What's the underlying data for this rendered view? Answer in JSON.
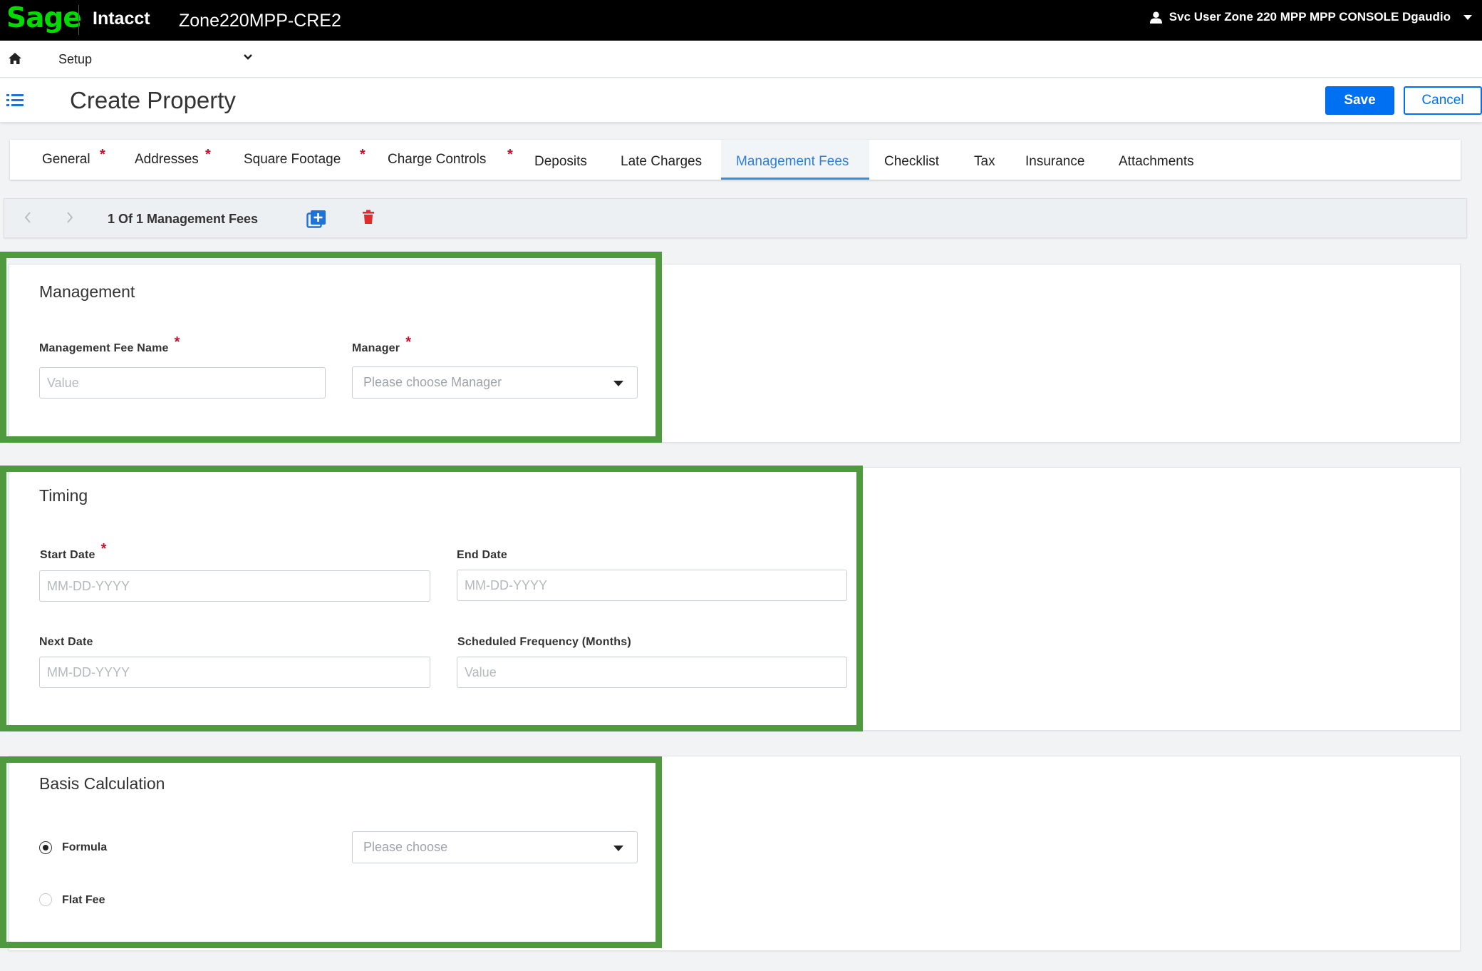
{
  "topbar": {
    "logo": "Sage",
    "product": "Intacct",
    "company": "Zone220MPP-CRE2",
    "user": "Svc User Zone 220 MPP MPP CONSOLE Dgaudio"
  },
  "nav": {
    "menu": "Setup"
  },
  "header": {
    "title": "Create Property",
    "save_label": "Save",
    "cancel_label": "Cancel"
  },
  "tabs": [
    {
      "label": "General",
      "required": "*"
    },
    {
      "label": "Addresses",
      "required": "*"
    },
    {
      "label": "Square Footage",
      "required": "*"
    },
    {
      "label": "Charge Controls",
      "required": "*"
    },
    {
      "label": "Deposits"
    },
    {
      "label": "Late Charges"
    },
    {
      "label": "Management Fees",
      "active": true
    },
    {
      "label": "Checklist"
    },
    {
      "label": "Tax"
    },
    {
      "label": "Insurance"
    },
    {
      "label": "Attachments"
    }
  ],
  "toolbar": {
    "record_count": "1 Of 1 Management Fees"
  },
  "management": {
    "title": "Management",
    "fee_name_label": "Management Fee Name",
    "fee_name_placeholder": "Value",
    "manager_label": "Manager",
    "manager_placeholder": "Please choose Manager",
    "required": "*"
  },
  "timing": {
    "title": "Timing",
    "start_date_label": "Start Date",
    "start_date_placeholder": "MM-DD-YYYY",
    "end_date_label": "End Date",
    "end_date_placeholder": "MM-DD-YYYY",
    "next_date_label": "Next Date",
    "next_date_placeholder": "MM-DD-YYYY",
    "frequency_label": "Scheduled Frequency (Months)",
    "frequency_placeholder": "Value",
    "required": "*"
  },
  "basis": {
    "title": "Basis Calculation",
    "formula_label": "Formula",
    "flat_fee_label": "Flat Fee",
    "formula_select_placeholder": "Please choose",
    "selected": "Formula"
  },
  "colors": {
    "brand_green": "#00dc00",
    "primary_blue": "#0070f2",
    "highlight_green": "#4f9a3e",
    "required_red": "#c8102e"
  }
}
